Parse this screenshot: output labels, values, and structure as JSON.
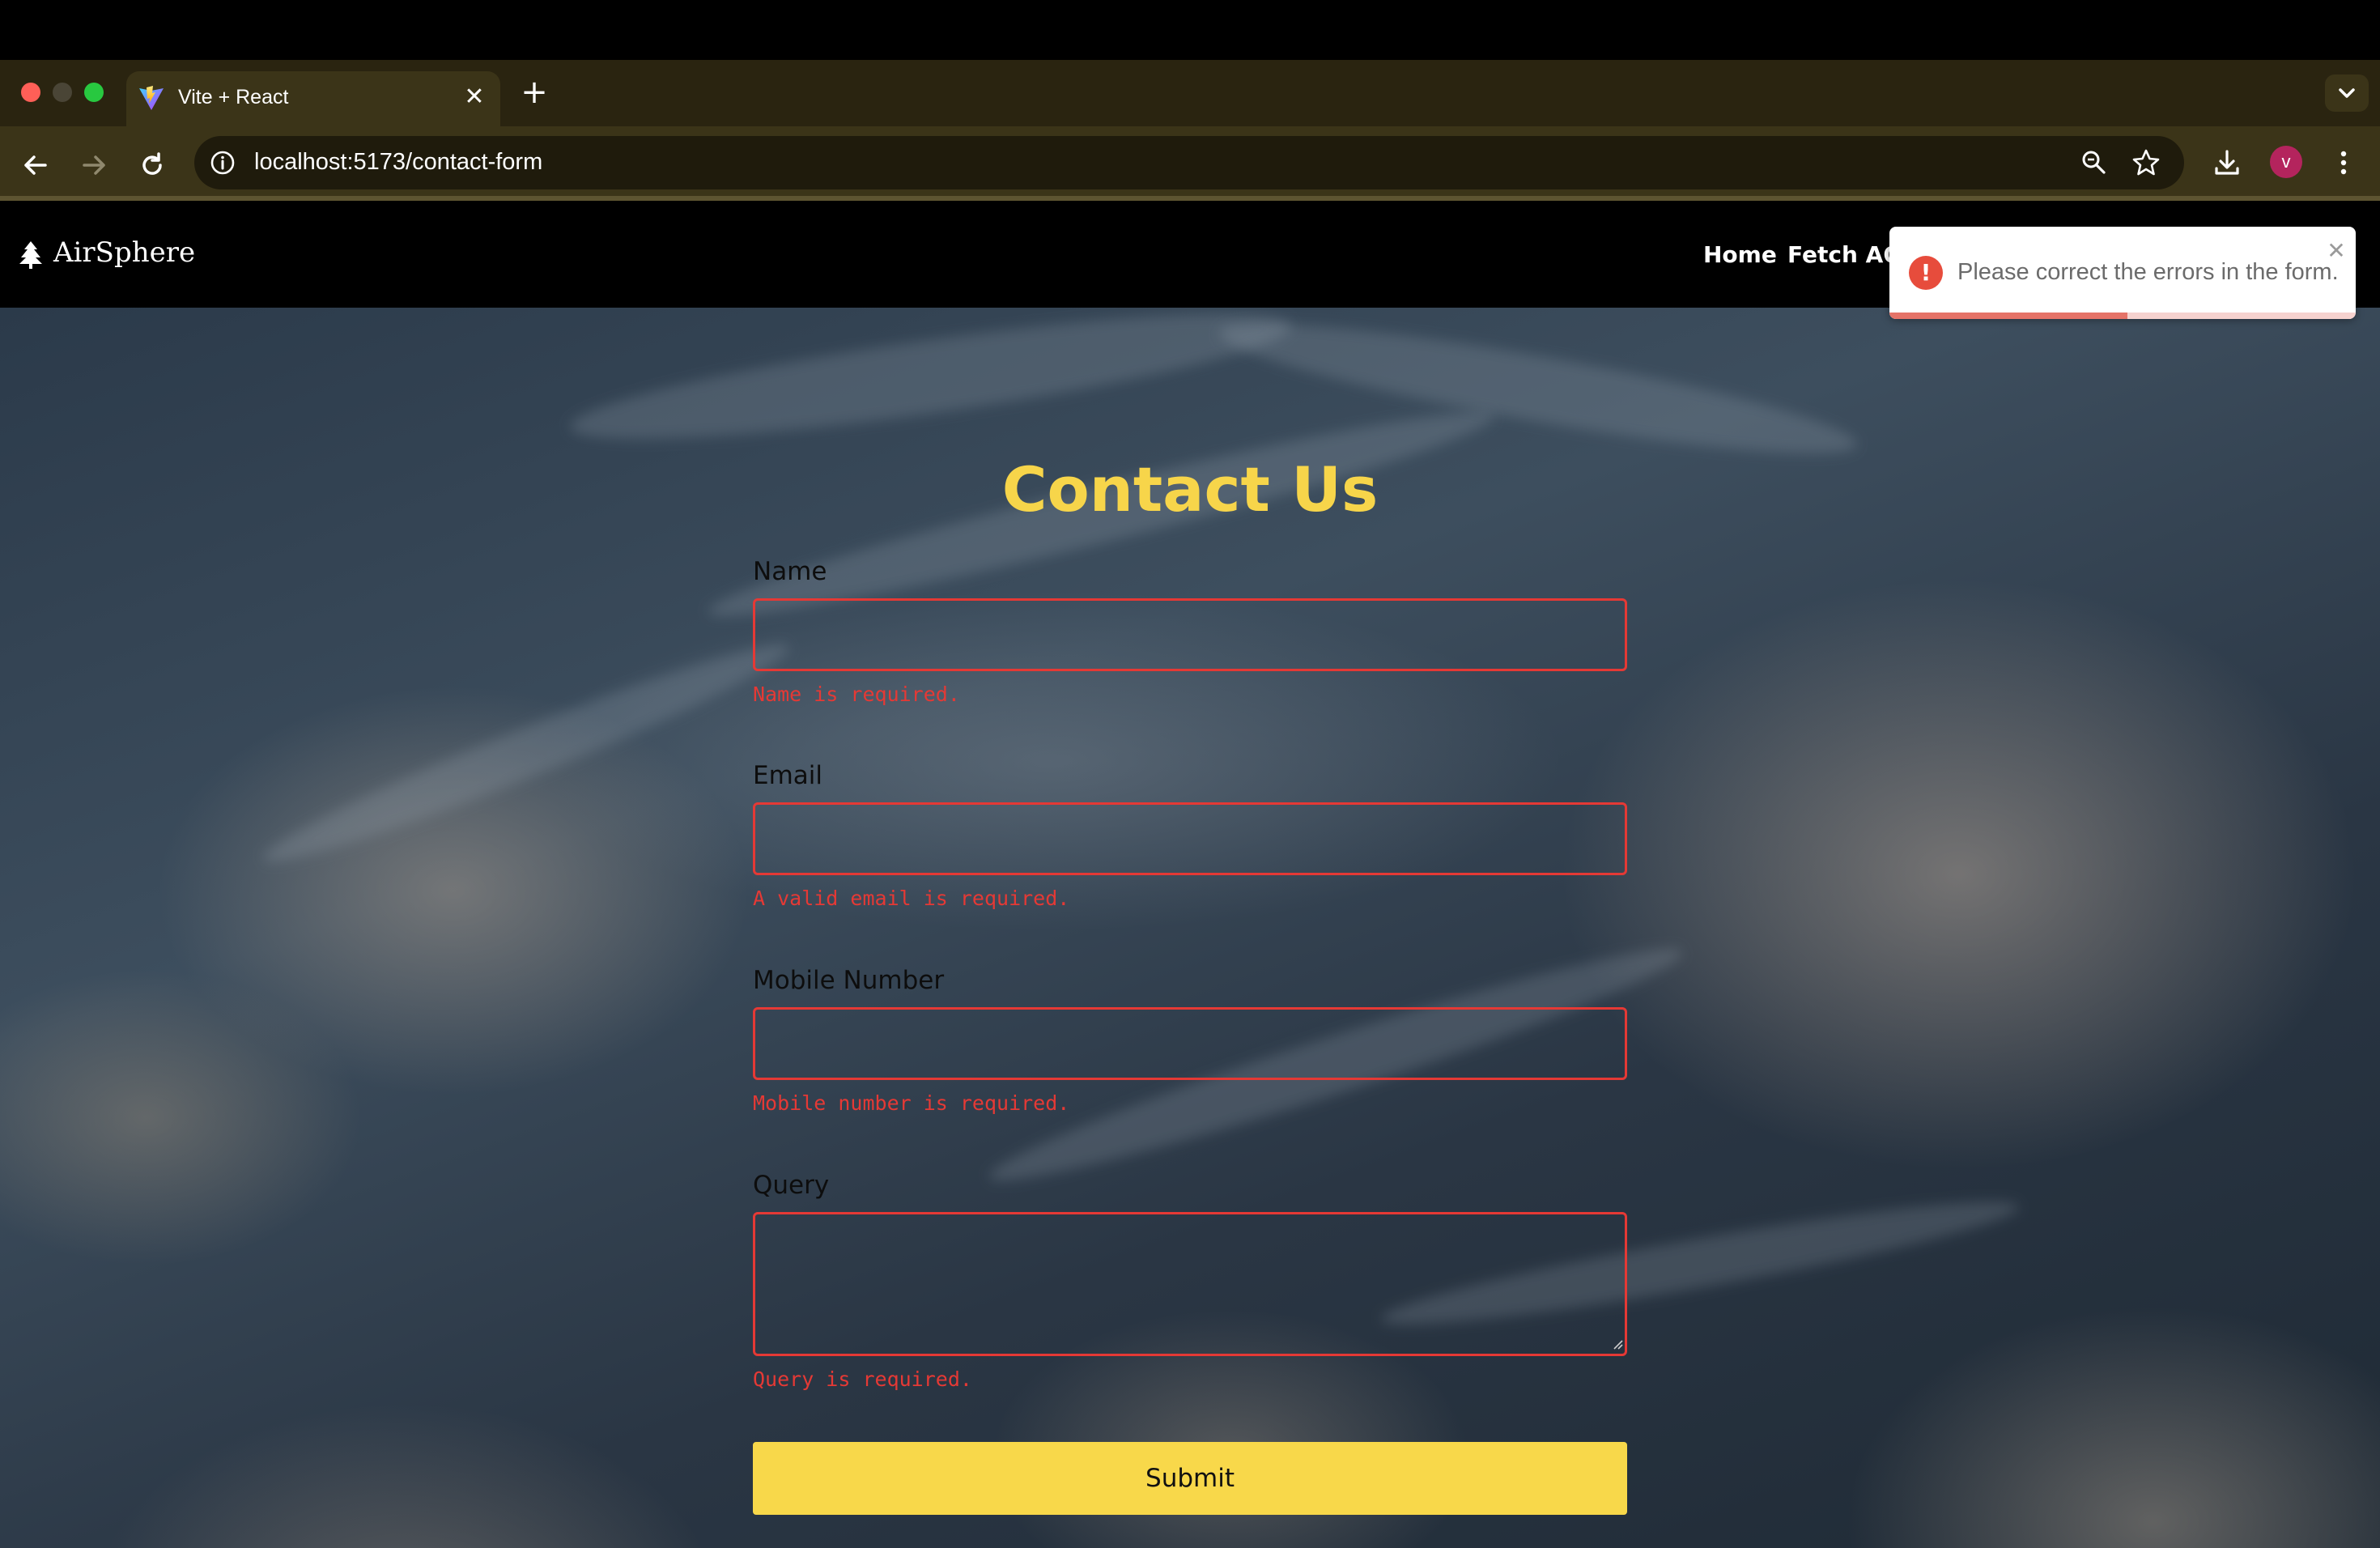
{
  "browser": {
    "tab_title": "Vite + React",
    "tab_close_glyph": "✕",
    "new_tab_glyph": "+",
    "url": "localhost:5173/contact-form",
    "profile_initial": "v",
    "icons": [
      "back-icon",
      "forward-icon",
      "reload-icon",
      "site-info-icon",
      "zoom-icon",
      "bookmark-star-icon",
      "download-icon",
      "menu-dots-icon",
      "chevron-down-icon"
    ]
  },
  "header": {
    "brand": "AirSphere",
    "brand_icon": "tree-icon",
    "nav": [
      "Home",
      "Fetch AQI"
    ]
  },
  "form": {
    "title": "Contact Us",
    "fields": [
      {
        "label": "Name",
        "value": "",
        "error": "Name is required."
      },
      {
        "label": "Email",
        "value": "",
        "error": "A valid email is required."
      },
      {
        "label": "Mobile Number",
        "value": "",
        "error": "Mobile number is required."
      },
      {
        "label": "Query",
        "value": "",
        "error": "Query is required."
      }
    ],
    "submit_label": "Submit"
  },
  "toast": {
    "message": "Please correct the errors in the form.",
    "icon": "error-alert-icon",
    "icon_glyph": "!",
    "close_glyph": "✕",
    "progress_fraction": 0.51
  },
  "colors": {
    "accent_yellow": "#f7d54a",
    "error_red": "#e53935",
    "toast_red": "#e74c3c",
    "chrome_bg": "#3b3418",
    "avatar": "#b4245d"
  }
}
